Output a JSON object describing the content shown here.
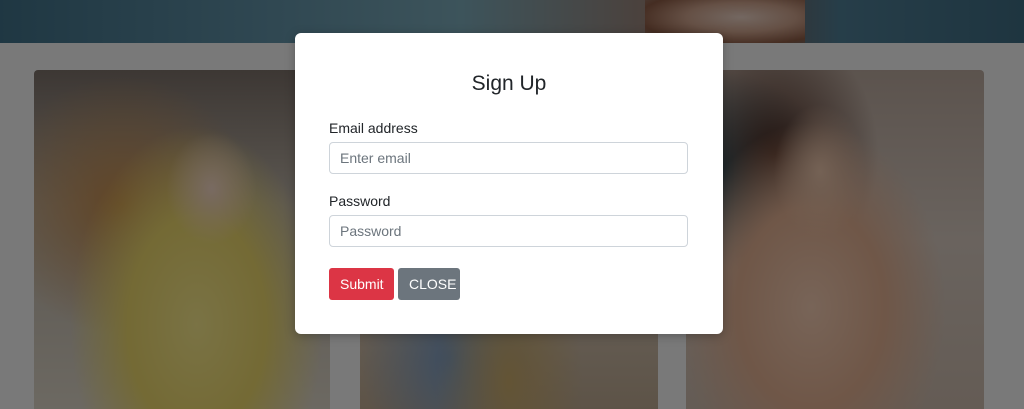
{
  "modal": {
    "title": "Sign Up",
    "email": {
      "label": "Email address",
      "placeholder": "Enter email",
      "value": ""
    },
    "password": {
      "label": "Password",
      "placeholder": "Password",
      "value": ""
    },
    "submit_label": "Submit",
    "close_label": "CLOSE"
  },
  "colors": {
    "submit_button": "#dc3545",
    "close_button": "#6c757d",
    "backdrop": "rgba(0,0,0,0.5)"
  }
}
